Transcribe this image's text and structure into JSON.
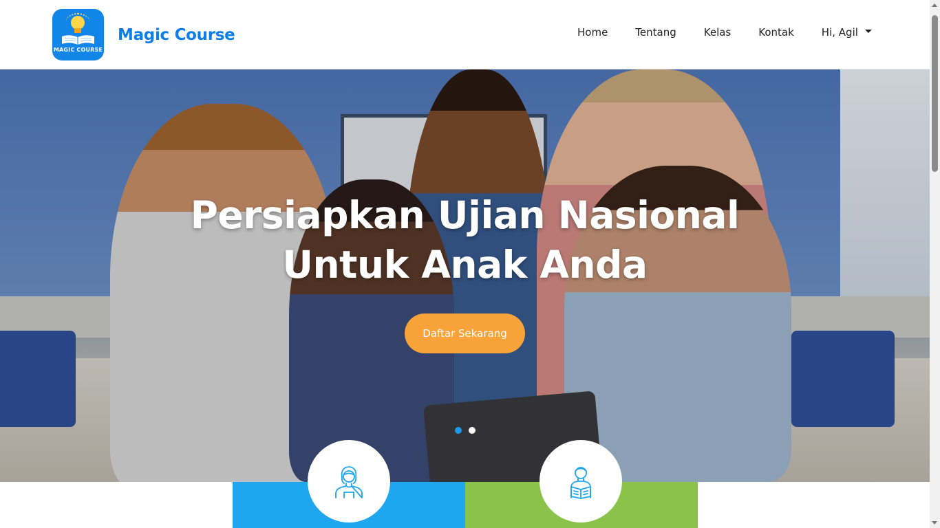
{
  "brand": {
    "name": "Magic Course",
    "logo_text": "MAGIC COURSE",
    "logo_icon": "lightbulb-book-icon"
  },
  "nav": {
    "items": [
      "Home",
      "Tentang",
      "Kelas",
      "Kontak"
    ],
    "user_label": "Hi, Agil",
    "user_icon": "caret-down-icon"
  },
  "hero": {
    "title_line1": "Persiapkan Ujian Nasional",
    "title_line2": "Untuk Anak Anda",
    "cta_label": "Daftar Sekarang",
    "slides": 2,
    "active_slide": 1
  },
  "features": [
    {
      "icon": "female-teacher-icon",
      "color": "#1ea6ee"
    },
    {
      "icon": "student-reading-icon",
      "color": "#8bc34a"
    }
  ],
  "colors": {
    "brand": "#0d7de8",
    "cta": "#f7a33a",
    "carousel_active": "#1a9be8"
  }
}
